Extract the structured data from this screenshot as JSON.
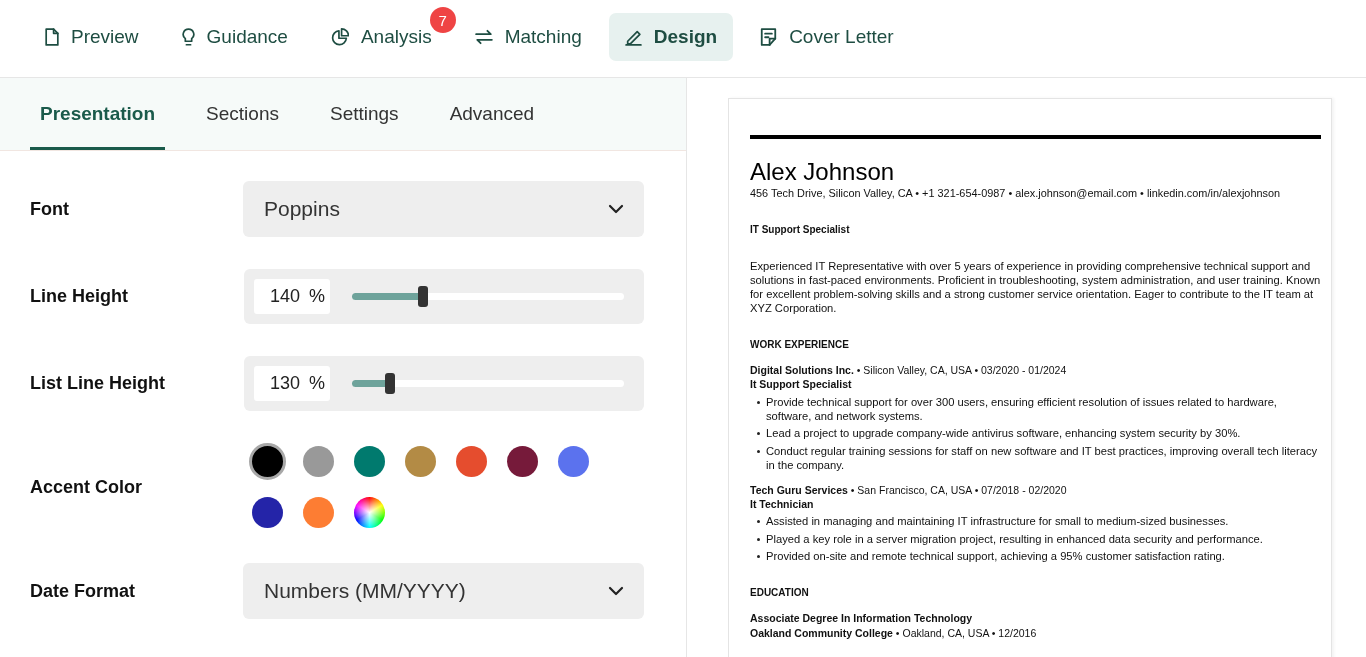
{
  "top_nav": {
    "tabs": [
      {
        "label": "Preview",
        "selected": false
      },
      {
        "label": "Guidance",
        "selected": false
      },
      {
        "label": "Analysis",
        "selected": false,
        "badge": "7"
      },
      {
        "label": "Matching",
        "selected": false
      },
      {
        "label": "Design",
        "selected": true
      },
      {
        "label": "Cover Letter",
        "selected": false
      }
    ]
  },
  "design_panel": {
    "tabs": [
      {
        "label": "Presentation",
        "selected": true
      },
      {
        "label": "Sections",
        "selected": false
      },
      {
        "label": "Settings",
        "selected": false
      },
      {
        "label": "Advanced",
        "selected": false
      }
    ],
    "settings": [
      {
        "kind": "dropdown",
        "label": "Font",
        "value": "Poppins"
      },
      {
        "kind": "slider",
        "label": "Line Height",
        "value": "140",
        "unit": "%",
        "level": 0.26
      },
      {
        "kind": "slider",
        "label": "List Line Height",
        "value": "130",
        "unit": "%",
        "level": 0.14
      },
      {
        "kind": "colors",
        "label": "Accent Color",
        "swatches": [
          {
            "kind": "swatch",
            "color": "#000000",
            "selected": true
          },
          {
            "kind": "swatch",
            "color": "#999999",
            "selected": false
          },
          {
            "kind": "swatch",
            "color": "#007a6e",
            "selected": false
          },
          {
            "kind": "swatch",
            "color": "#b38b45",
            "selected": false
          },
          {
            "kind": "swatch",
            "color": "#e54d2e",
            "selected": false
          },
          {
            "kind": "swatch",
            "color": "#761a3a",
            "selected": false
          },
          {
            "kind": "swatch",
            "color": "#5b72ee",
            "selected": false
          },
          {
            "kind": "swatch",
            "color": "#2424a8",
            "selected": false
          },
          {
            "kind": "swatch",
            "color": "#fd7d33",
            "selected": false
          },
          {
            "kind": "picker",
            "selected": false
          }
        ]
      },
      {
        "kind": "dropdown",
        "label": "Date Format",
        "value": "Numbers (MM/YYYY)"
      }
    ]
  },
  "resume": {
    "name": "Alex Johnson",
    "contact": "456 Tech Drive, Silicon Valley, CA • +1 321-654-0987 • alex.johnson@email.com • linkedin.com/in/alexjohnson",
    "title": "IT Support Specialist",
    "summary": "Experienced IT Representative with over 5 years of experience in providing comprehensive technical support and solutions in fast-paced environments. Proficient in troubleshooting, system administration, and user training. Known for excellent problem-solving skills and a strong customer service orientation. Eager to contribute to the IT team at XYZ Corporation.",
    "sections": [
      {
        "kind": "jobs",
        "heading": "WORK EXPERIENCE",
        "entries": [
          {
            "header": "**Digital Solutions Inc.** • Silicon Valley, CA, USA • 03/2020 - 01/2024",
            "role": "It Support Specialist",
            "bullets": [
              "Provide technical support for over 300 users, ensuring efficient resolution of issues related to hardware, software, and network systems.",
              "Lead a project to upgrade company-wide antivirus software, enhancing system security by 30%.",
              "Conduct regular training sessions for staff on new software and IT best practices, improving overall tech literacy in the company."
            ]
          },
          {
            "header": "**Tech Guru Services** • San Francisco, CA, USA • 07/2018 - 02/2020",
            "role": "It Technician",
            "bullets": [
              "Assisted in managing and maintaining IT infrastructure for small to medium-sized businesses.",
              "Played a key role in a server migration project, resulting in enhanced data security and performance.",
              "Provided on-site and remote technical support, achieving a 95% customer satisfaction rating."
            ]
          }
        ]
      },
      {
        "kind": "education",
        "heading": "EDUCATION",
        "entries": [
          {
            "degree": "Associate Degree In Information Technology",
            "school": "**Oakland Community College** • Oakland, CA, USA • 12/2016"
          }
        ]
      }
    ]
  }
}
